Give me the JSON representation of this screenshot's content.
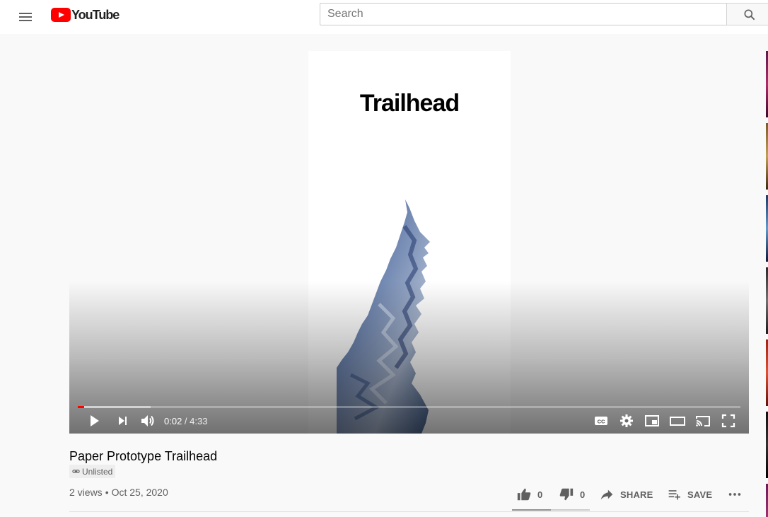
{
  "masthead": {
    "menu_icon": "hamburger-menu-icon",
    "logo_text": "YouTube",
    "search_placeholder": "Search",
    "search_icon": "search-icon"
  },
  "player": {
    "video_title_text": "Trailhead",
    "current_time": "0:02",
    "separator": " / ",
    "duration": "4:33",
    "progress_played_fraction": 0.01,
    "progress_loaded_fraction": 0.11,
    "controls": [
      "play-icon",
      "next-icon",
      "volume-icon",
      "captions-icon",
      "settings-gear-icon",
      "miniplayer-icon",
      "theater-mode-icon",
      "cast-icon",
      "fullscreen-icon"
    ]
  },
  "video": {
    "title": "Paper Prototype Trailhead",
    "privacy_badge": "Unlisted",
    "views": "2 views",
    "date": "Oct 25, 2020"
  },
  "actions": {
    "likes": "0",
    "dislikes": "0",
    "share_label": "SHARE",
    "save_label": "SAVE"
  },
  "colors": {
    "brand_red": "#ff0000",
    "text_primary": "#030303",
    "text_secondary": "#606060",
    "background": "#f9f9f9"
  }
}
